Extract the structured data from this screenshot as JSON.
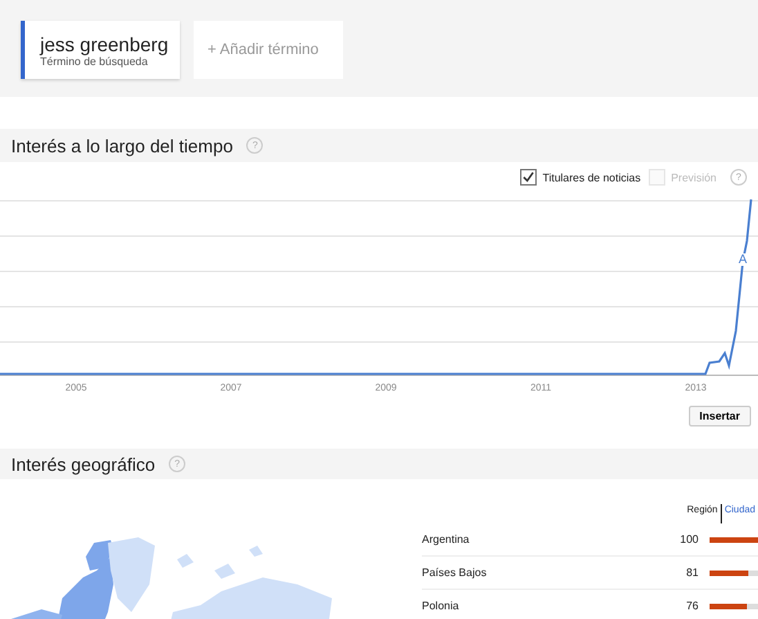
{
  "search_terms": [
    {
      "term": "jess greenberg",
      "subtitle": "Término de búsqueda",
      "color": "#3366cc"
    }
  ],
  "add_term": {
    "label": "+ Añadir término"
  },
  "interest_over_time": {
    "title": "Interés a lo largo del tiempo",
    "help": "?",
    "options": [
      {
        "label": "Titulares de noticias",
        "checked": true,
        "disabled": false
      },
      {
        "label": "Previsión",
        "checked": false,
        "disabled": true
      }
    ],
    "option_help": "?",
    "x_labels": [
      "2005",
      "2007",
      "2009",
      "2011",
      "2013"
    ],
    "annotation_marker": "A",
    "embed_button": "Insertar"
  },
  "geographic_interest": {
    "title": "Interés geográfico",
    "help": "?",
    "views": [
      {
        "label": "Región",
        "selected": true
      },
      {
        "label": "Ciudad",
        "selected": false
      }
    ],
    "rows": [
      {
        "name": "Argentina",
        "value": "100",
        "level": 1
      },
      {
        "name": "Países Bajos",
        "value": "81",
        "level": 0.81
      },
      {
        "name": "Polonia",
        "value": "76",
        "level": 0.76
      }
    ]
  }
}
